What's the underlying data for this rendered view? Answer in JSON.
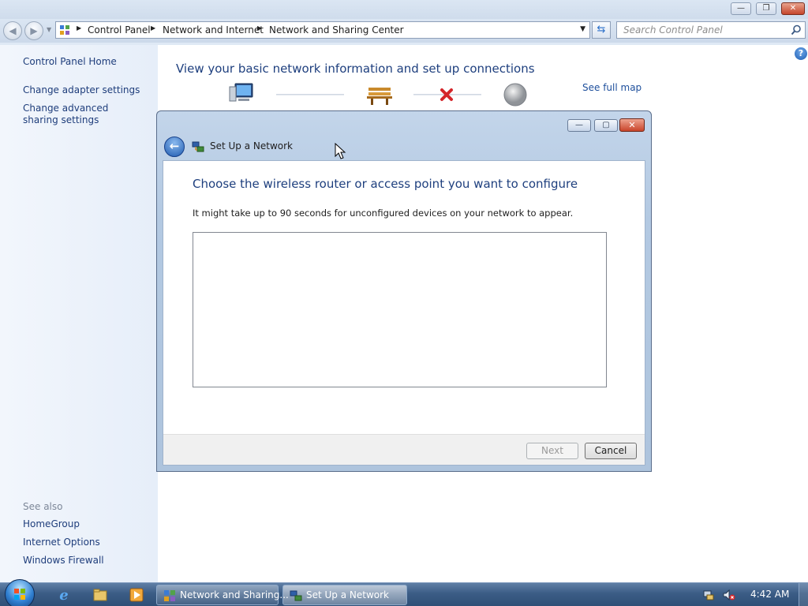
{
  "explorer": {
    "breadcrumbs": [
      "Control Panel",
      "Network and Internet",
      "Network and Sharing Center"
    ],
    "search_placeholder": "Search Control Panel",
    "window_buttons": {
      "minimize": "—",
      "maximize": "❐",
      "close": "✕"
    }
  },
  "sidebar": {
    "items": [
      {
        "label": "Control Panel Home"
      },
      {
        "label": "Change adapter settings"
      },
      {
        "label": "Change advanced sharing settings"
      }
    ],
    "see_also_label": "See also",
    "see_also": [
      {
        "label": "HomeGroup"
      },
      {
        "label": "Internet Options"
      },
      {
        "label": "Windows Firewall"
      }
    ]
  },
  "main": {
    "title": "View your basic network information and set up connections",
    "see_full_map": "See full map",
    "help_label": "?",
    "map_icons": [
      "computer-icon",
      "bench-icon",
      "disconnected-x-icon",
      "internet-globe-icon"
    ]
  },
  "dialog": {
    "title": "Set Up a Network",
    "heading": "Choose the wireless router or access point you want to configure",
    "description": "It might take up to 90 seconds for unconfigured devices on your network to appear.",
    "devices": [],
    "next_label": "Next",
    "next_enabled": false,
    "cancel_label": "Cancel",
    "back_label": "←",
    "window_buttons": {
      "minimize": "—",
      "maximize": "▢",
      "close": "✕"
    }
  },
  "taskbar": {
    "quick_launch": [
      "internet-explorer-icon",
      "windows-explorer-icon",
      "media-player-icon"
    ],
    "tasks": [
      {
        "label": "Network and Sharing...",
        "active": false
      },
      {
        "label": "Set Up a Network",
        "active": true
      }
    ],
    "clock": "4:42 AM"
  },
  "colors": {
    "link": "#1e3d7b",
    "heading": "#1e3f7e",
    "close_red": "#c9442a",
    "taskbar": "#3b5c85"
  }
}
